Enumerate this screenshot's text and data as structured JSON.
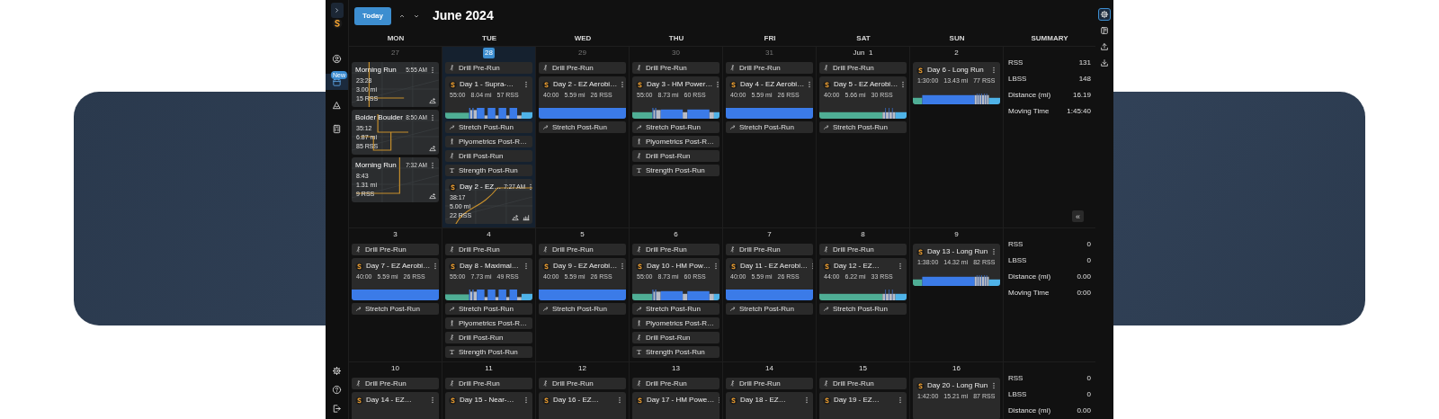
{
  "toolbar": {
    "today_button": "Today",
    "month": "June 2024"
  },
  "nav_items": [
    {
      "kind": "profile",
      "selected": false
    },
    {
      "kind": "calendar",
      "selected": true,
      "badge": "New"
    },
    {
      "kind": "routes",
      "selected": false
    },
    {
      "kind": "calculator",
      "selected": false
    }
  ],
  "nav_footer": [
    {
      "kind": "settings"
    },
    {
      "kind": "help"
    },
    {
      "kind": "logout"
    }
  ],
  "tools": [
    {
      "kind": "settings",
      "selected": true
    },
    {
      "kind": "book",
      "selected": false
    },
    {
      "kind": "upload",
      "selected": false
    },
    {
      "kind": "download",
      "selected": false
    }
  ],
  "collapse_button": "«",
  "weekdays": [
    "MON",
    "TUE",
    "WED",
    "THU",
    "FRI",
    "SAT",
    "SUN"
  ],
  "summary_heading": "SUMMARY",
  "weeks": [
    {
      "days": [
        {
          "date": "27",
          "muted": true,
          "today": false,
          "items": [
            {
              "kind": "activity",
              "title": "Morning Run",
              "time": "5:55 AM",
              "duration": "23:28",
              "distance": "3.00 mi",
              "rss": "15 RSS",
              "planned": false
            },
            {
              "kind": "activity",
              "title": "Bolder Boulder",
              "time": "8:50 AM",
              "duration": "35:12",
              "distance": "6.87 mi",
              "rss": "85 RSS",
              "planned": false
            },
            {
              "kind": "activity",
              "title": "Morning Run",
              "time": "7:32 AM",
              "duration": "8:43",
              "distance": "1.31 mi",
              "rss": "9 RSS",
              "planned": false
            }
          ]
        },
        {
          "date": "28",
          "muted": false,
          "today": true,
          "items": [
            {
              "kind": "drill",
              "label": "Drill Pre-Run"
            },
            {
              "kind": "workout",
              "title": "Day 1 - Supra-…",
              "duration": "55:00",
              "distance": "8.04 mi",
              "rss": "57 RSS",
              "profile": {
                "kind": "intervals"
              }
            },
            {
              "kind": "stretch",
              "label": "Stretch Post-Run"
            },
            {
              "kind": "plyometrics",
              "label": "Plyometrics Post-R…"
            },
            {
              "kind": "drill",
              "label": "Drill Post-Run"
            },
            {
              "kind": "strength",
              "label": "Strength Post-Run"
            },
            {
              "kind": "activity",
              "title": "Day 2 - EZ…",
              "time": "7:27 AM",
              "duration": "38:17",
              "distance": "5.00 mi",
              "rss": "22 RSS",
              "planned": true
            }
          ]
        },
        {
          "date": "29",
          "muted": true,
          "today": false,
          "items": [
            {
              "kind": "drill",
              "label": "Drill Pre-Run"
            },
            {
              "kind": "workout",
              "title": "Day 2 - EZ Aerobi…",
              "duration": "40:00",
              "distance": "5.59 mi",
              "rss": "26 RSS",
              "profile": {
                "kind": "steady"
              }
            },
            {
              "kind": "stretch",
              "label": "Stretch Post-Run"
            }
          ]
        },
        {
          "date": "30",
          "muted": true,
          "today": false,
          "items": [
            {
              "kind": "drill",
              "label": "Drill Pre-Run"
            },
            {
              "kind": "workout",
              "title": "Day 3 - HM Power…",
              "duration": "55:00",
              "distance": "8.73 mi",
              "rss": "60 RSS",
              "profile": {
                "kind": "tempo"
              }
            },
            {
              "kind": "stretch",
              "label": "Stretch Post-Run"
            },
            {
              "kind": "plyometrics",
              "label": "Plyometrics Post-R…"
            },
            {
              "kind": "drill",
              "label": "Drill Post-Run"
            },
            {
              "kind": "strength",
              "label": "Strength Post-Run"
            }
          ]
        },
        {
          "date": "31",
          "muted": true,
          "today": false,
          "items": [
            {
              "kind": "drill",
              "label": "Drill Pre-Run"
            },
            {
              "kind": "workout",
              "title": "Day 4 - EZ Aerobi…",
              "duration": "40:00",
              "distance": "5.59 mi",
              "rss": "26 RSS",
              "profile": {
                "kind": "steady"
              }
            },
            {
              "kind": "stretch",
              "label": "Stretch Post-Run"
            }
          ]
        },
        {
          "date": "Jun  1",
          "muted": false,
          "today": false,
          "items": [
            {
              "kind": "drill",
              "label": "Drill Pre-Run"
            },
            {
              "kind": "workout",
              "title": "Day 5 - EZ Aerobi…",
              "duration": "40:00",
              "distance": "5.66 mi",
              "rss": "30 RSS",
              "profile": {
                "kind": "strides"
              }
            },
            {
              "kind": "stretch",
              "label": "Stretch Post-Run"
            }
          ]
        },
        {
          "date": "2",
          "muted": false,
          "today": false,
          "items": [
            {
              "kind": "workout",
              "title": "Day 6 - Long Run",
              "duration": "1:30:00",
              "distance": "13.43 mi",
              "rss": "77 RSS",
              "profile": {
                "kind": "long"
              }
            }
          ]
        }
      ],
      "summary": [
        {
          "label": "RSS",
          "value": "131"
        },
        {
          "label": "LBSS",
          "value": "148"
        },
        {
          "label": "Distance (mi)",
          "value": "16.19"
        },
        {
          "label": "Moving Time",
          "value": "1:45:40"
        }
      ]
    },
    {
      "days": [
        {
          "date": "3",
          "muted": false,
          "today": false,
          "items": [
            {
              "kind": "drill",
              "label": "Drill Pre-Run"
            },
            {
              "kind": "workout",
              "title": "Day 7 - EZ Aerobi…",
              "duration": "40:00",
              "distance": "5.59 mi",
              "rss": "26 RSS",
              "profile": {
                "kind": "steady"
              }
            },
            {
              "kind": "stretch",
              "label": "Stretch Post-Run"
            }
          ]
        },
        {
          "date": "4",
          "muted": false,
          "today": false,
          "items": [
            {
              "kind": "drill",
              "label": "Drill Pre-Run"
            },
            {
              "kind": "workout",
              "title": "Day 8 - Maximal…",
              "duration": "55:00",
              "distance": "7.73 mi",
              "rss": "49 RSS",
              "profile": {
                "kind": "intervals"
              }
            },
            {
              "kind": "stretch",
              "label": "Stretch Post-Run"
            },
            {
              "kind": "plyometrics",
              "label": "Plyometrics Post-R…"
            },
            {
              "kind": "drill",
              "label": "Drill Post-Run"
            },
            {
              "kind": "strength",
              "label": "Strength Post-Run"
            }
          ]
        },
        {
          "date": "5",
          "muted": false,
          "today": false,
          "items": [
            {
              "kind": "drill",
              "label": "Drill Pre-Run"
            },
            {
              "kind": "workout",
              "title": "Day 9 - EZ Aerobi…",
              "duration": "40:00",
              "distance": "5.59 mi",
              "rss": "26 RSS",
              "profile": {
                "kind": "steady"
              }
            },
            {
              "kind": "stretch",
              "label": "Stretch Post-Run"
            }
          ]
        },
        {
          "date": "6",
          "muted": false,
          "today": false,
          "items": [
            {
              "kind": "drill",
              "label": "Drill Pre-Run"
            },
            {
              "kind": "workout",
              "title": "Day 10 - HM Pow…",
              "duration": "55:00",
              "distance": "8.73 mi",
              "rss": "60 RSS",
              "profile": {
                "kind": "tempo"
              }
            },
            {
              "kind": "stretch",
              "label": "Stretch Post-Run"
            },
            {
              "kind": "plyometrics",
              "label": "Plyometrics Post-R…"
            },
            {
              "kind": "drill",
              "label": "Drill Post-Run"
            },
            {
              "kind": "strength",
              "label": "Strength Post-Run"
            }
          ]
        },
        {
          "date": "7",
          "muted": false,
          "today": false,
          "items": [
            {
              "kind": "drill",
              "label": "Drill Pre-Run"
            },
            {
              "kind": "workout",
              "title": "Day 11 - EZ Aerobi…",
              "duration": "40:00",
              "distance": "5.59 mi",
              "rss": "26 RSS",
              "profile": {
                "kind": "steady"
              }
            },
            {
              "kind": "stretch",
              "label": "Stretch Post-Run"
            }
          ]
        },
        {
          "date": "8",
          "muted": false,
          "today": false,
          "items": [
            {
              "kind": "drill",
              "label": "Drill Pre-Run"
            },
            {
              "kind": "workout",
              "title": "Day 12 - EZ…",
              "duration": "44:00",
              "distance": "6.22 mi",
              "rss": "33 RSS",
              "profile": {
                "kind": "strides"
              }
            },
            {
              "kind": "stretch",
              "label": "Stretch Post-Run"
            }
          ]
        },
        {
          "date": "9",
          "muted": false,
          "today": false,
          "items": [
            {
              "kind": "workout",
              "title": "Day 13 - Long Run",
              "duration": "1:38:00",
              "distance": "14.32 mi",
              "rss": "82 RSS",
              "profile": {
                "kind": "long"
              }
            }
          ]
        }
      ],
      "summary": [
        {
          "label": "RSS",
          "value": "0"
        },
        {
          "label": "LBSS",
          "value": "0"
        },
        {
          "label": "Distance (mi)",
          "value": "0.00"
        },
        {
          "label": "Moving Time",
          "value": "0:00"
        }
      ]
    },
    {
      "days": [
        {
          "date": "10",
          "muted": false,
          "today": false,
          "items": [
            {
              "kind": "drill",
              "label": "Drill Pre-Run"
            },
            {
              "kind": "workout",
              "title": "Day 14 - EZ…"
            }
          ]
        },
        {
          "date": "11",
          "muted": false,
          "today": false,
          "items": [
            {
              "kind": "drill",
              "label": "Drill Pre-Run"
            },
            {
              "kind": "workout",
              "title": "Day 15 - Near-…"
            }
          ]
        },
        {
          "date": "12",
          "muted": false,
          "today": false,
          "items": [
            {
              "kind": "drill",
              "label": "Drill Pre-Run"
            },
            {
              "kind": "workout",
              "title": "Day 16 - EZ…"
            }
          ]
        },
        {
          "date": "13",
          "muted": false,
          "today": false,
          "items": [
            {
              "kind": "drill",
              "label": "Drill Pre-Run"
            },
            {
              "kind": "workout",
              "title": "Day 17 - HM Powe…"
            }
          ]
        },
        {
          "date": "14",
          "muted": false,
          "today": false,
          "items": [
            {
              "kind": "drill",
              "label": "Drill Pre-Run"
            },
            {
              "kind": "workout",
              "title": "Day 18 - EZ…"
            }
          ]
        },
        {
          "date": "15",
          "muted": false,
          "today": false,
          "items": [
            {
              "kind": "drill",
              "label": "Drill Pre-Run"
            },
            {
              "kind": "workout",
              "title": "Day 19 - EZ…"
            }
          ]
        },
        {
          "date": "16",
          "muted": false,
          "today": false,
          "items": [
            {
              "kind": "workout",
              "title": "Day 20 - Long Run",
              "duration": "1:42:00",
              "distance": "15.21 mi",
              "rss": "87 RSS"
            }
          ]
        }
      ],
      "summary": [
        {
          "label": "RSS",
          "value": "0"
        },
        {
          "label": "LBSS",
          "value": "0"
        },
        {
          "label": "Distance (mi)",
          "value": "0.00"
        }
      ]
    }
  ]
}
